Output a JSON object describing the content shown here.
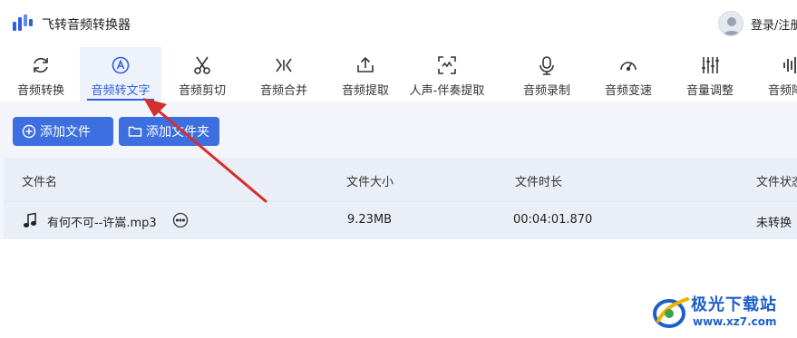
{
  "app": {
    "title": "飞转音频转换器",
    "login_label": "登录/注册"
  },
  "toolbar": {
    "items": [
      {
        "label": "音频转换",
        "icon": "refresh-icon"
      },
      {
        "label": "音频转文字",
        "icon": "audio-to-text-icon",
        "active": true
      },
      {
        "label": "音频剪切",
        "icon": "scissors-icon"
      },
      {
        "label": "音频合并",
        "icon": "merge-icon"
      },
      {
        "label": "音频提取",
        "icon": "extract-icon"
      },
      {
        "label": "人声-伴奏提取",
        "icon": "vocal-extract-icon"
      },
      {
        "label": "音频录制",
        "icon": "microphone-icon"
      },
      {
        "label": "音频变速",
        "icon": "speedometer-icon"
      },
      {
        "label": "音量调整",
        "icon": "volume-sliders-icon"
      },
      {
        "label": "音频降噪",
        "icon": "waveform-icon"
      }
    ]
  },
  "actions": {
    "add_file": "添加文件",
    "add_folder": "添加文件夹"
  },
  "table": {
    "headers": [
      "文件名",
      "文件大小",
      "文件时长",
      "文件状态"
    ],
    "rows": [
      {
        "name": "有何不可--许嵩.mp3",
        "size": "9.23MB",
        "duration": "00:04:01.870",
        "status": "未转换"
      }
    ]
  },
  "watermark": {
    "title": "极光下载站",
    "url": "www.xz7.com"
  },
  "colors": {
    "accent": "#2f5fe0",
    "button": "#3d6fe0",
    "arrow": "#d32f2f",
    "content_bg": "#f3f5fa"
  }
}
